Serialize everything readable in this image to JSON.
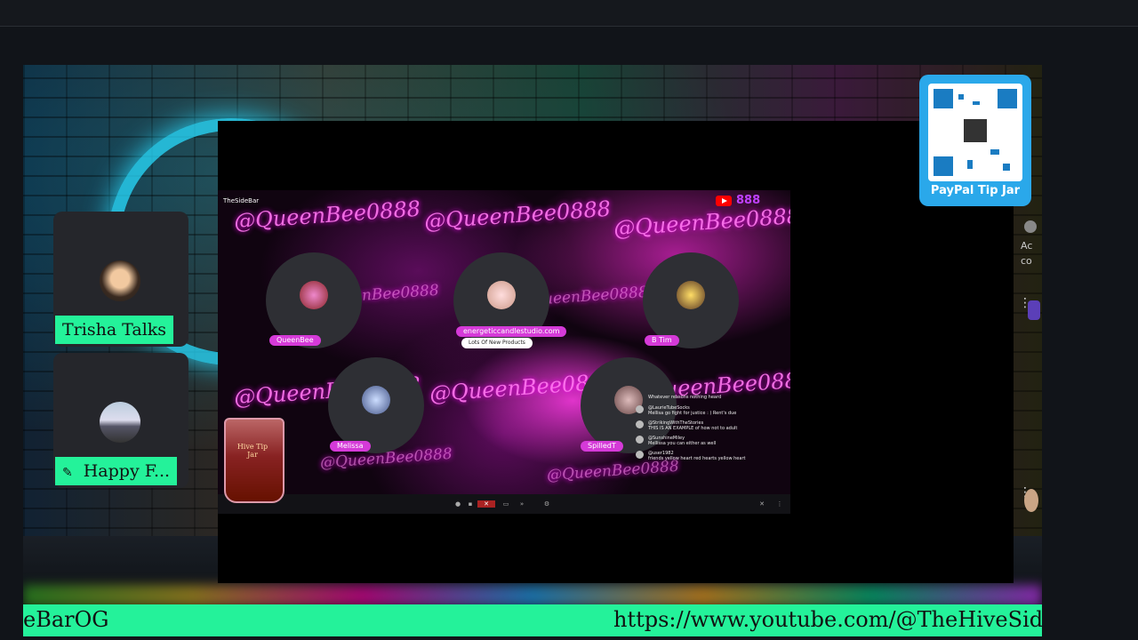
{
  "qr": {
    "label": "PayPal Tip Jar"
  },
  "guests": [
    {
      "label": "Trisha Talks",
      "muted": false
    },
    {
      "label": "Happy F...",
      "muted": true
    }
  ],
  "shared_screen": {
    "watermark": "@QueenBee0888",
    "broadcast_name": "TheSideBar",
    "viewer_count": "888",
    "participants": [
      {
        "name": "QueenBee"
      },
      {
        "name": "energeticcandlestudio.com",
        "sub": "Lots Of New Products"
      },
      {
        "name": "B Tim"
      },
      {
        "name": "Melissa"
      },
      {
        "name": "SpilledT"
      }
    ],
    "chat": [
      {
        "user": "@LaurieTubeSocks",
        "text": "Mellisa go fight for justice : ) Rent's due"
      },
      {
        "user": "@StrikingWithTheStories",
        "text": "THIS IS AN EXAMPLE of how not to adult"
      },
      {
        "user": "@SunshineMiley",
        "text": "Mellissa you can either as well"
      },
      {
        "user": "@user1982",
        "text": "friends yellow heart red hearts yellow heart"
      }
    ],
    "chat_header": "Whatever reasons nothing heard"
  },
  "sidebar_fragments": [
    "Ac",
    "co"
  ],
  "ticker": {
    "left_text": "eBarOG",
    "right_text": "https://www.youtube.com/@TheHiveSideBa"
  },
  "cup": {
    "text": "Hive Tip Jar"
  }
}
